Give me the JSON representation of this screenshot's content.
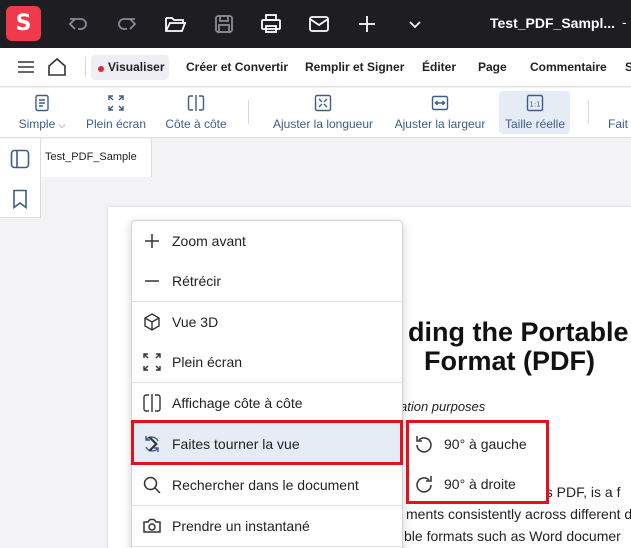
{
  "titlebar": {
    "app_logo": "S",
    "document_title": "Test_PDF_Sampl...",
    "window_control": "-",
    "icons": [
      "undo-icon",
      "redo-icon",
      "folder-open-icon",
      "save-icon",
      "print-icon",
      "mail-icon",
      "plus-icon",
      "chevron-down-icon"
    ]
  },
  "menubar": {
    "items": [
      {
        "label": "Visualiser",
        "active": true
      },
      {
        "label": "Créer et Convertir"
      },
      {
        "label": "Remplir et Signer"
      },
      {
        "label": "Éditer"
      },
      {
        "label": "Page"
      },
      {
        "label": "Commentaire"
      },
      {
        "label": "S"
      }
    ]
  },
  "toolbar": {
    "items": [
      {
        "label": "Simple",
        "icon": "page-icon",
        "dropdown": true
      },
      {
        "label": "Plein écran",
        "icon": "expand-icon"
      },
      {
        "label": "Côte à côte",
        "icon": "side-by-side-icon"
      },
      {
        "label": "Ajuster la longueur",
        "icon": "fit-page-icon"
      },
      {
        "label": "Ajuster la largeur",
        "icon": "fit-width-icon"
      },
      {
        "label": "Taille réelle",
        "icon": "actual-size-icon",
        "active": true
      },
      {
        "label": "Fait",
        "icon": ""
      }
    ]
  },
  "tab": {
    "label": "Test_PDF_Sample"
  },
  "document": {
    "heading_line1": "ding the Portable",
    "heading_line2": "Format (PDF)",
    "subtitle": "ation purposes",
    "line1": "as PDF, is a f",
    "line2": "ments consistently across different d",
    "line3": "ble formats such as Word documer"
  },
  "context_menu": {
    "items": [
      {
        "label": "Zoom avant",
        "icon": "zoom-in-plus-icon"
      },
      {
        "label": "Rétrécir",
        "icon": "zoom-out-minus-icon"
      },
      {
        "label": "Vue 3D",
        "icon": "cube-3d-icon"
      },
      {
        "label": "Plein écran",
        "icon": "fullscreen-icon"
      },
      {
        "label": "Affichage côte à côte",
        "icon": "side-by-side-icon"
      },
      {
        "label": "Faites tourner la vue",
        "icon": "rotate-view-icon",
        "has_submenu": true,
        "highlighted": true
      },
      {
        "label": "Rechercher dans le document",
        "icon": "search-icon"
      },
      {
        "label": "Prendre un instantané",
        "icon": "camera-icon"
      }
    ]
  },
  "submenu": {
    "items": [
      {
        "label": "90° à gauche",
        "icon": "rotate-left-icon"
      },
      {
        "label": "90° à droite",
        "icon": "rotate-right-icon"
      }
    ]
  },
  "colors": {
    "titlebar_bg": "#1e1e22",
    "logo_red": "#f0394a",
    "highlight_red": "#e3101e",
    "toolbar_blue": "#3e5d86",
    "active_bg": "#e6ecf6"
  }
}
